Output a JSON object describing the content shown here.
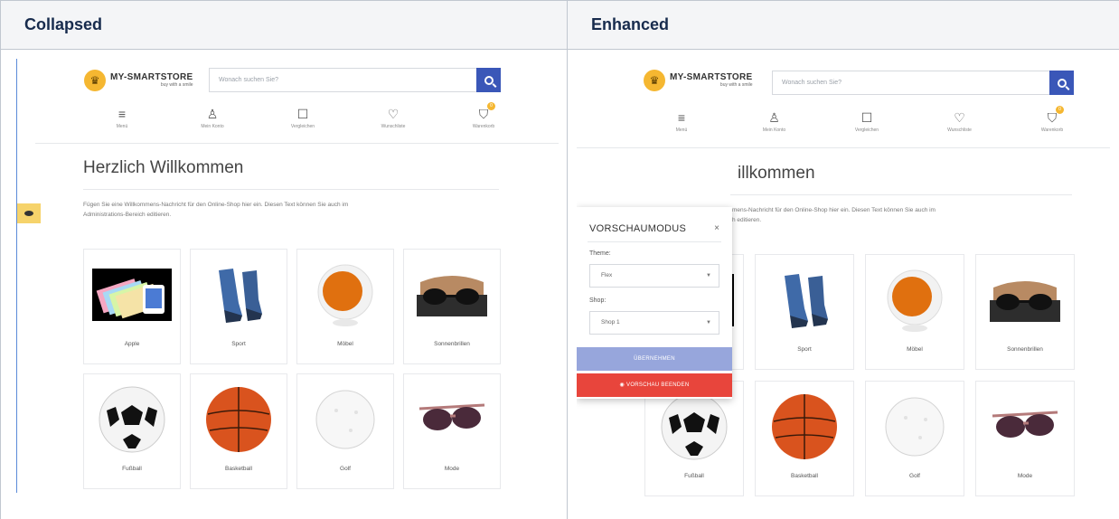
{
  "columns": {
    "collapsed": "Collapsed",
    "enhanced": "Enhanced"
  },
  "store": {
    "logo_name": "MY-SMARTSTORE",
    "logo_tagline": "buy with a smile",
    "search_placeholder": "Wonach suchen Sie?",
    "nav": [
      {
        "label": "Menü",
        "icon": "menu-icon"
      },
      {
        "label": "Mein Konto",
        "icon": "user-icon"
      },
      {
        "label": "Vergleichen",
        "icon": "compare-icon"
      },
      {
        "label": "Wunschliste",
        "icon": "heart-icon"
      },
      {
        "label": "Warenkorb",
        "icon": "cart-icon",
        "badge": "0"
      }
    ],
    "welcome_title": "Herzlich Willkommen",
    "welcome_text_line1": "Fügen Sie eine Willkommens-Nachricht für den Online-Shop hier ein. Diesen Text können Sie auch im",
    "welcome_text_line2": "Administrations-Bereich editieren.",
    "enhanced_title_fragment": "illkommen",
    "enhanced_text_line1": "mens-Nachricht für den Online-Shop hier ein. Diesen Text können Sie auch im",
    "enhanced_text_line2": "h editieren.",
    "categories": [
      "Apple",
      "Sport",
      "Möbel",
      "Sonnenbrillen",
      "Fußball",
      "Basketball",
      "Golf",
      "Mode"
    ]
  },
  "preview_panel": {
    "title": "VORSCHAUMODUS",
    "close": "×",
    "theme_label": "Theme:",
    "theme_value": "Flex",
    "shop_label": "Shop:",
    "shop_value": "Shop 1",
    "apply_label": "ÜBERNEHMEN",
    "end_label": "VORSCHAU BEENDEN"
  }
}
